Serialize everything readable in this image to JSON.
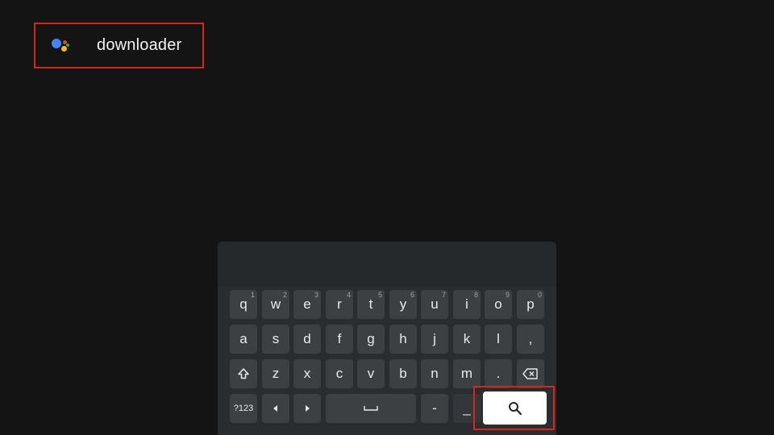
{
  "search": {
    "query": "downloader"
  },
  "keyboard": {
    "row1": [
      {
        "label": "q",
        "hint": "1"
      },
      {
        "label": "w",
        "hint": "2"
      },
      {
        "label": "e",
        "hint": "3"
      },
      {
        "label": "r",
        "hint": "4"
      },
      {
        "label": "t",
        "hint": "5"
      },
      {
        "label": "y",
        "hint": "6"
      },
      {
        "label": "u",
        "hint": "7"
      },
      {
        "label": "i",
        "hint": "8"
      },
      {
        "label": "o",
        "hint": "9"
      },
      {
        "label": "p",
        "hint": "0"
      }
    ],
    "row2": [
      {
        "label": "a"
      },
      {
        "label": "s"
      },
      {
        "label": "d"
      },
      {
        "label": "f"
      },
      {
        "label": "g"
      },
      {
        "label": "h"
      },
      {
        "label": "j"
      },
      {
        "label": "k"
      },
      {
        "label": "l"
      },
      {
        "label": ","
      }
    ],
    "row3": {
      "shift_icon": "shift-icon",
      "letters": [
        "z",
        "x",
        "c",
        "v",
        "b",
        "n",
        "m",
        "."
      ],
      "backspace_icon": "backspace-icon"
    },
    "row4": {
      "symbols_label": "?123",
      "left_icon": "arrow-left-icon",
      "right_icon": "arrow-right-icon",
      "space_icon": "space-icon",
      "dash": "-",
      "underscore": "_",
      "search_icon": "search-icon"
    }
  },
  "colors": {
    "highlight": "#d8261c",
    "background": "#141414",
    "key": "#3c4043"
  }
}
